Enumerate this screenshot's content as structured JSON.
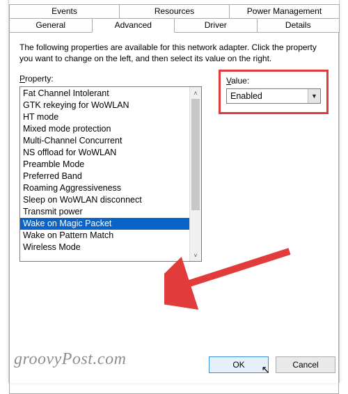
{
  "tabs": {
    "row1": [
      "Events",
      "Resources",
      "Power Management"
    ],
    "row2": [
      "General",
      "Advanced",
      "Driver",
      "Details"
    ],
    "active": "Advanced"
  },
  "intro": "The following properties are available for this network adapter. Click the property you want to change on the left, and then select its value on the right.",
  "property": {
    "label_pre": "P",
    "label_post": "roperty:",
    "items": [
      "Fat Channel Intolerant",
      "GTK rekeying for WoWLAN",
      "HT mode",
      "Mixed mode protection",
      "Multi-Channel Concurrent",
      "NS offload for WoWLAN",
      "Preamble Mode",
      "Preferred Band",
      "Roaming Aggressiveness",
      "Sleep on WoWLAN disconnect",
      "Transmit power",
      "Wake on Magic Packet",
      "Wake on Pattern Match",
      "Wireless Mode"
    ],
    "selected_index": 11
  },
  "value": {
    "label_pre": "V",
    "label_post": "alue:",
    "selected": "Enabled"
  },
  "buttons": {
    "ok": "OK",
    "cancel": "Cancel"
  },
  "watermark": "groovyPost.com",
  "highlight_color": "#e23b3b"
}
